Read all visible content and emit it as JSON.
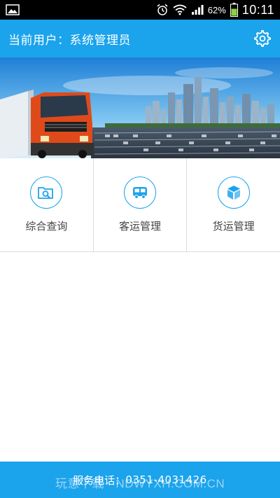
{
  "status_bar": {
    "battery_percent": "62%",
    "time": "10:11",
    "icons": [
      "gallery-icon",
      "alarm-icon",
      "wifi-icon",
      "signal-icon",
      "battery-icon"
    ]
  },
  "header": {
    "user_label": "当前用户：",
    "user_name": "系统管理员",
    "settings_icon": "gear-icon"
  },
  "menu": {
    "items": [
      {
        "label": "综合查询",
        "icon": "search-folder-icon"
      },
      {
        "label": "客运管理",
        "icon": "bus-icon"
      },
      {
        "label": "货运管理",
        "icon": "package-icon"
      }
    ]
  },
  "footer": {
    "service_label": "服务电话：",
    "phone": "0351-4031426"
  },
  "watermark": {
    "text": "玩意下载 · NDWYXH.COM.CN"
  },
  "colors": {
    "accent": "#1ba3ec",
    "status_bar": "#000000",
    "label": "#444444",
    "divider": "#dcdcdc"
  }
}
